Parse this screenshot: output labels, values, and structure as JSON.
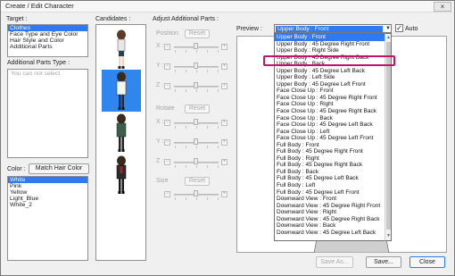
{
  "window": {
    "title": "Create / Edit Character",
    "close_glyph": "×"
  },
  "target": {
    "label": "Target :",
    "items": [
      {
        "label": "Clothes",
        "selected": true
      },
      {
        "label": "Face Type and Eye Color",
        "selected": false
      },
      {
        "label": "Hair Style and Color",
        "selected": false
      },
      {
        "label": "Additional Parts",
        "selected": false
      }
    ]
  },
  "additional_parts_type": {
    "label": "Additional Parts Type :",
    "message": "You can not select."
  },
  "color": {
    "label": "Color :",
    "match_button": "Match Hair Color",
    "items": [
      {
        "label": "White",
        "selected": true
      },
      {
        "label": "Pink",
        "selected": false
      },
      {
        "label": "Yellow",
        "selected": false
      },
      {
        "label": "Light_Blue",
        "selected": false
      },
      {
        "label": "White_2",
        "selected": false
      }
    ]
  },
  "candidates": {
    "label": "Candidates :",
    "selected_index": 1,
    "count": 4
  },
  "adjust": {
    "label": "Adjust Additional Parts :",
    "position_label": "Position",
    "rotate_label": "Rotate",
    "size_label": "Size",
    "reset_label": "Reset",
    "x_label": "X :",
    "y_label": "Y :",
    "z_label": "Z :",
    "minus": "−",
    "plus": "+"
  },
  "preview": {
    "label": "Preview :",
    "selected_value": "Upper Body : Front",
    "auto_label": "Auto",
    "auto_checked": true,
    "options": [
      "Upper Body : Front",
      "Upper Body : 45 Degree Right Front",
      "Upper Body : Right Side",
      "Upper Body : 45 Degree Right Back",
      "Upper Body : Back",
      "Upper Body : 45 Degree Left Back",
      "Upper Body : Left Side",
      "Upper Body : 45 Degree Left Front",
      "Face Close Up : Front",
      "Face Close Up : 45 Degree Right Front",
      "Face Close Up : Right",
      "Face Close Up : 45 Degree Right Back",
      "Face Close Up : Back",
      "Face Close Up : 45 Degree Left Back",
      "Face Close Up : Left",
      "Face Close Up : 45 Degree Left Front",
      "Full Body : Front",
      "Full Body : 45 Degree Right Front",
      "Full Body : Right",
      "Full Body : 45 Degree Right Back",
      "Full Body : Back",
      "Full Body : 45 Degree Left Back",
      "Full Body : Left",
      "Full Body : 45 Degree Left Front",
      "Downward View : Front",
      "Downward View : 45 Degree Right Front",
      "Downward View : Right",
      "Downward View : 45 Degree Right Back",
      "Downward View : Back",
      "Downward View : 45 Degree Left Back"
    ],
    "highlighted_index": 4,
    "highlight_color": "#c0146a"
  },
  "footer": {
    "save_as": "Save As...",
    "save": "Save...",
    "close": "Close"
  },
  "colors": {
    "accent": "#3179f0",
    "highlight_box": "#c0146a",
    "candidate_selected": "#2f86ee"
  }
}
